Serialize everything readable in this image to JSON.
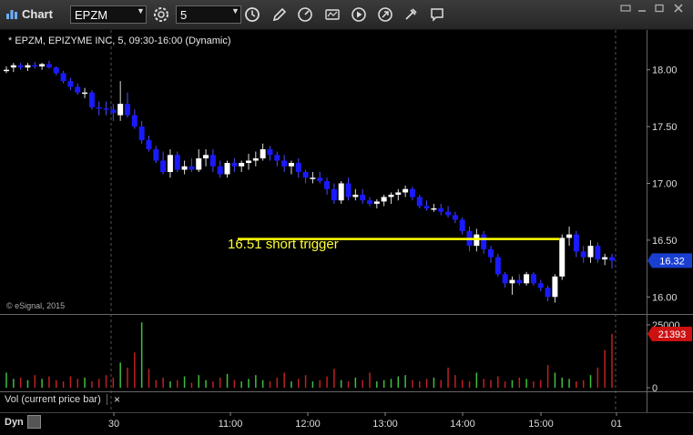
{
  "toolbar": {
    "app_title": "Chart",
    "symbol": "EPZM",
    "interval": "5"
  },
  "chart": {
    "title_line": "* EPZM, EPIZYME INC, 5, 09:30-16:00 (Dynamic)",
    "watermark": "© eSignal, 2015",
    "annotation": "16.51 short trigger",
    "last_price_badge": "16.32",
    "last_volume_badge": "21393",
    "volume_study_label": "Vol (current price bar)",
    "dyn_label": "Dyn"
  },
  "colors": {
    "up_candle": "#ffffff",
    "down_candle": "#1a1aff",
    "trigger_line": "#ffff00",
    "vol_up": "#3fbf3f",
    "vol_down": "#c02020",
    "price_badge": "#1a3fd0",
    "volume_badge": "#cc1111"
  },
  "icons": [
    "settings-icon",
    "clock-icon",
    "pencil-icon",
    "speedometer-icon",
    "studies-icon",
    "play-icon",
    "tools-icon",
    "cursor-icon",
    "comment-icon"
  ],
  "chart_data": {
    "type": "candlestick",
    "price_axis": {
      "ticks": [
        "18.00",
        "17.50",
        "17.00",
        "16.50",
        "16.00"
      ],
      "range": [
        15.85,
        18.35
      ]
    },
    "volume_axis": {
      "ticks": [
        "25000",
        "0"
      ],
      "range": [
        0,
        25000
      ]
    },
    "time_axis": {
      "ticks": [
        "30",
        "11:00",
        "12:00",
        "13:00",
        "14:00",
        "15:00",
        "01"
      ]
    },
    "trigger_level": 16.51,
    "candles": [
      [
        18.0,
        18.03,
        17.97,
        18.0
      ],
      [
        18.02,
        18.06,
        17.98,
        18.04
      ],
      [
        18.04,
        18.06,
        18.0,
        18.02
      ],
      [
        18.02,
        18.06,
        17.99,
        18.04
      ],
      [
        18.04,
        18.07,
        18.01,
        18.03
      ],
      [
        18.03,
        18.06,
        18.0,
        18.05
      ],
      [
        18.05,
        18.08,
        18.01,
        18.02
      ],
      [
        18.02,
        18.03,
        17.95,
        17.97
      ],
      [
        17.97,
        17.99,
        17.88,
        17.9
      ],
      [
        17.9,
        17.93,
        17.82,
        17.85
      ],
      [
        17.85,
        17.88,
        17.78,
        17.8
      ],
      [
        17.8,
        17.84,
        17.75,
        17.8
      ],
      [
        17.8,
        17.82,
        17.65,
        17.67
      ],
      [
        17.67,
        17.72,
        17.6,
        17.66
      ],
      [
        17.66,
        17.72,
        17.6,
        17.65
      ],
      [
        17.65,
        17.7,
        17.55,
        17.62
      ],
      [
        17.6,
        17.9,
        17.55,
        17.7
      ],
      [
        17.7,
        17.8,
        17.58,
        17.6
      ],
      [
        17.6,
        17.65,
        17.48,
        17.5
      ],
      [
        17.5,
        17.55,
        17.35,
        17.38
      ],
      [
        17.38,
        17.42,
        17.28,
        17.3
      ],
      [
        17.3,
        17.33,
        17.18,
        17.2
      ],
      [
        17.2,
        17.28,
        17.08,
        17.1
      ],
      [
        17.1,
        17.3,
        17.05,
        17.25
      ],
      [
        17.25,
        17.28,
        17.1,
        17.12
      ],
      [
        17.12,
        17.2,
        17.08,
        17.15
      ],
      [
        17.15,
        17.22,
        17.1,
        17.12
      ],
      [
        17.12,
        17.3,
        17.1,
        17.22
      ],
      [
        17.22,
        17.3,
        17.15,
        17.25
      ],
      [
        17.25,
        17.3,
        17.1,
        17.15
      ],
      [
        17.15,
        17.2,
        17.05,
        17.08
      ],
      [
        17.08,
        17.2,
        17.05,
        17.18
      ],
      [
        17.18,
        17.22,
        17.1,
        17.15
      ],
      [
        17.15,
        17.2,
        17.1,
        17.18
      ],
      [
        17.18,
        17.26,
        17.12,
        17.2
      ],
      [
        17.2,
        17.28,
        17.15,
        17.22
      ],
      [
        17.22,
        17.35,
        17.2,
        17.3
      ],
      [
        17.3,
        17.33,
        17.2,
        17.25
      ],
      [
        17.25,
        17.28,
        17.15,
        17.2
      ],
      [
        17.2,
        17.25,
        17.1,
        17.15
      ],
      [
        17.15,
        17.2,
        17.08,
        17.18
      ],
      [
        17.18,
        17.22,
        17.05,
        17.1
      ],
      [
        17.1,
        17.12,
        17.0,
        17.05
      ],
      [
        17.05,
        17.1,
        17.0,
        17.05
      ],
      [
        17.05,
        17.1,
        17.0,
        17.02
      ],
      [
        17.02,
        17.05,
        16.9,
        16.95
      ],
      [
        16.95,
        17.0,
        16.82,
        16.85
      ],
      [
        16.85,
        17.02,
        16.82,
        17.0
      ],
      [
        17.0,
        17.05,
        16.85,
        16.88
      ],
      [
        16.88,
        16.95,
        16.85,
        16.9
      ],
      [
        16.9,
        16.95,
        16.82,
        16.85
      ],
      [
        16.85,
        16.88,
        16.8,
        16.82
      ],
      [
        16.82,
        16.86,
        16.78,
        16.84
      ],
      [
        16.84,
        16.9,
        16.8,
        16.88
      ],
      [
        16.88,
        16.92,
        16.82,
        16.9
      ],
      [
        16.9,
        16.95,
        16.85,
        16.92
      ],
      [
        16.92,
        16.98,
        16.88,
        16.95
      ],
      [
        16.95,
        16.97,
        16.85,
        16.88
      ],
      [
        16.88,
        16.9,
        16.78,
        16.8
      ],
      [
        16.8,
        16.85,
        16.76,
        16.78
      ],
      [
        16.78,
        16.82,
        16.75,
        16.78
      ],
      [
        16.78,
        16.82,
        16.72,
        16.75
      ],
      [
        16.75,
        16.8,
        16.7,
        16.72
      ],
      [
        16.72,
        16.75,
        16.65,
        16.68
      ],
      [
        16.68,
        16.7,
        16.55,
        16.58
      ],
      [
        16.58,
        16.62,
        16.4,
        16.45
      ],
      [
        16.45,
        16.6,
        16.4,
        16.55
      ],
      [
        16.55,
        16.58,
        16.38,
        16.42
      ],
      [
        16.42,
        16.45,
        16.3,
        16.35
      ],
      [
        16.35,
        16.38,
        16.18,
        16.2
      ],
      [
        16.2,
        16.22,
        16.08,
        16.12
      ],
      [
        16.12,
        16.18,
        16.02,
        16.15
      ],
      [
        16.15,
        16.2,
        16.1,
        16.12
      ],
      [
        16.12,
        16.22,
        16.1,
        16.2
      ],
      [
        16.2,
        16.22,
        16.1,
        16.12
      ],
      [
        16.12,
        16.15,
        16.05,
        16.08
      ],
      [
        16.08,
        16.1,
        15.96,
        16.0
      ],
      [
        16.0,
        16.2,
        15.95,
        16.18
      ],
      [
        16.18,
        16.55,
        16.15,
        16.52
      ],
      [
        16.52,
        16.62,
        16.45,
        16.55
      ],
      [
        16.55,
        16.58,
        16.35,
        16.4
      ],
      [
        16.4,
        16.45,
        16.3,
        16.35
      ],
      [
        16.35,
        16.5,
        16.3,
        16.45
      ],
      [
        16.45,
        16.48,
        16.3,
        16.33
      ],
      [
        16.33,
        16.38,
        16.28,
        16.35
      ],
      [
        16.35,
        16.38,
        16.25,
        16.32
      ]
    ],
    "volumes": [
      6000,
      3500,
      4000,
      3000,
      5000,
      3500,
      4500,
      3000,
      2500,
      4500,
      3500,
      4000,
      2500,
      3500,
      5000,
      4000,
      10000,
      8000,
      14000,
      26000,
      7500,
      3000,
      4000,
      2500,
      3000,
      4500,
      2000,
      5000,
      3000,
      2500,
      4000,
      5500,
      3000,
      2500,
      3500,
      5000,
      3000,
      2500,
      4000,
      6000,
      2500,
      3500,
      5000,
      2500,
      3000,
      4500,
      7500,
      3000,
      2500,
      4000,
      3000,
      6000,
      2500,
      3000,
      3500,
      4500,
      5000,
      3000,
      2500,
      3500,
      4000,
      3000,
      8000,
      5000,
      3000,
      2500,
      6000,
      3500,
      3000,
      4500,
      2500,
      3000,
      4000,
      3500,
      2500,
      3000,
      9000,
      6000,
      4000,
      3500,
      2500,
      3000,
      5000,
      8000,
      15000,
      21393
    ],
    "volume_up": [
      1,
      1,
      0,
      1,
      0,
      1,
      0,
      0,
      0,
      0,
      0,
      1,
      0,
      0,
      0,
      0,
      1,
      0,
      0,
      1,
      0,
      0,
      0,
      1,
      0,
      1,
      0,
      1,
      1,
      0,
      0,
      1,
      0,
      1,
      1,
      1,
      1,
      0,
      0,
      0,
      1,
      0,
      0,
      1,
      0,
      0,
      0,
      1,
      0,
      1,
      0,
      0,
      1,
      1,
      1,
      1,
      1,
      0,
      0,
      0,
      1,
      0,
      0,
      0,
      0,
      0,
      1,
      0,
      0,
      0,
      0,
      1,
      0,
      1,
      0,
      0,
      0,
      1,
      1,
      1,
      0,
      0,
      1,
      0,
      0,
      0
    ]
  }
}
